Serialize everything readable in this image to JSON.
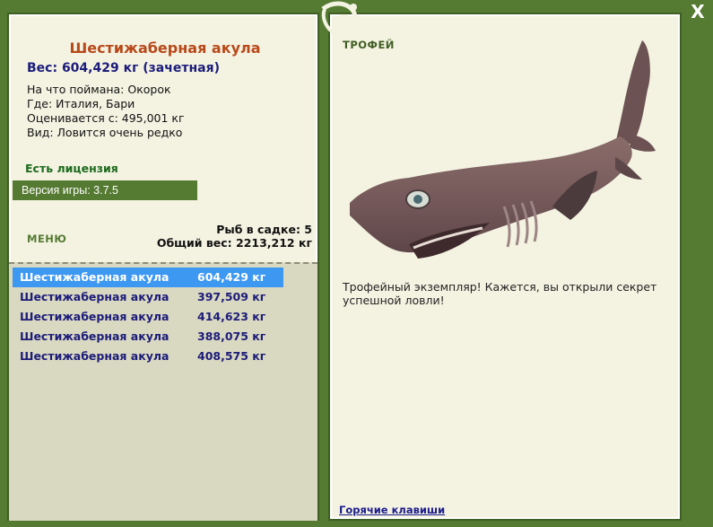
{
  "fish": {
    "name": "Шестижаберная акула",
    "weight": "Вес: 604,429 кг (зачетная)",
    "bait": "На что поймана: Окорок",
    "location": "Где: Италия, Бари",
    "value": "Оценивается с: 495,001 кг",
    "rarity": "Вид: Ловится очень редко"
  },
  "license": "Есть лицензия",
  "version": "Версия игры: 3.7.5",
  "menu_label": "МЕНЮ",
  "stats": {
    "count": "Рыб в садке: 5",
    "total": "Общий вес: 2213,212 кг"
  },
  "catch_list": [
    {
      "name": "Шестижаберная акула",
      "weight": "604,429 кг"
    },
    {
      "name": "Шестижаберная акула",
      "weight": "397,509 кг"
    },
    {
      "name": "Шестижаберная акула",
      "weight": "414,623 кг"
    },
    {
      "name": "Шестижаберная акула",
      "weight": "388,075 кг"
    },
    {
      "name": "Шестижаберная акула",
      "weight": "408,575 кг"
    }
  ],
  "trophy": {
    "title": "ТРОФЕЙ",
    "text": "Трофейный экземпляр! Кажется, вы открыли секрет успешной ловли!"
  },
  "hotkeys_link": "Горячие клавиши",
  "close_label": "X",
  "icons": [
    "lizard-logo-icon",
    "shark-image"
  ],
  "colors": {
    "frame": "#557a32",
    "panel": "#f4f3e2",
    "selected": "#3d98f2",
    "title": "#b8491a",
    "value_text": "#1c1c7a"
  }
}
